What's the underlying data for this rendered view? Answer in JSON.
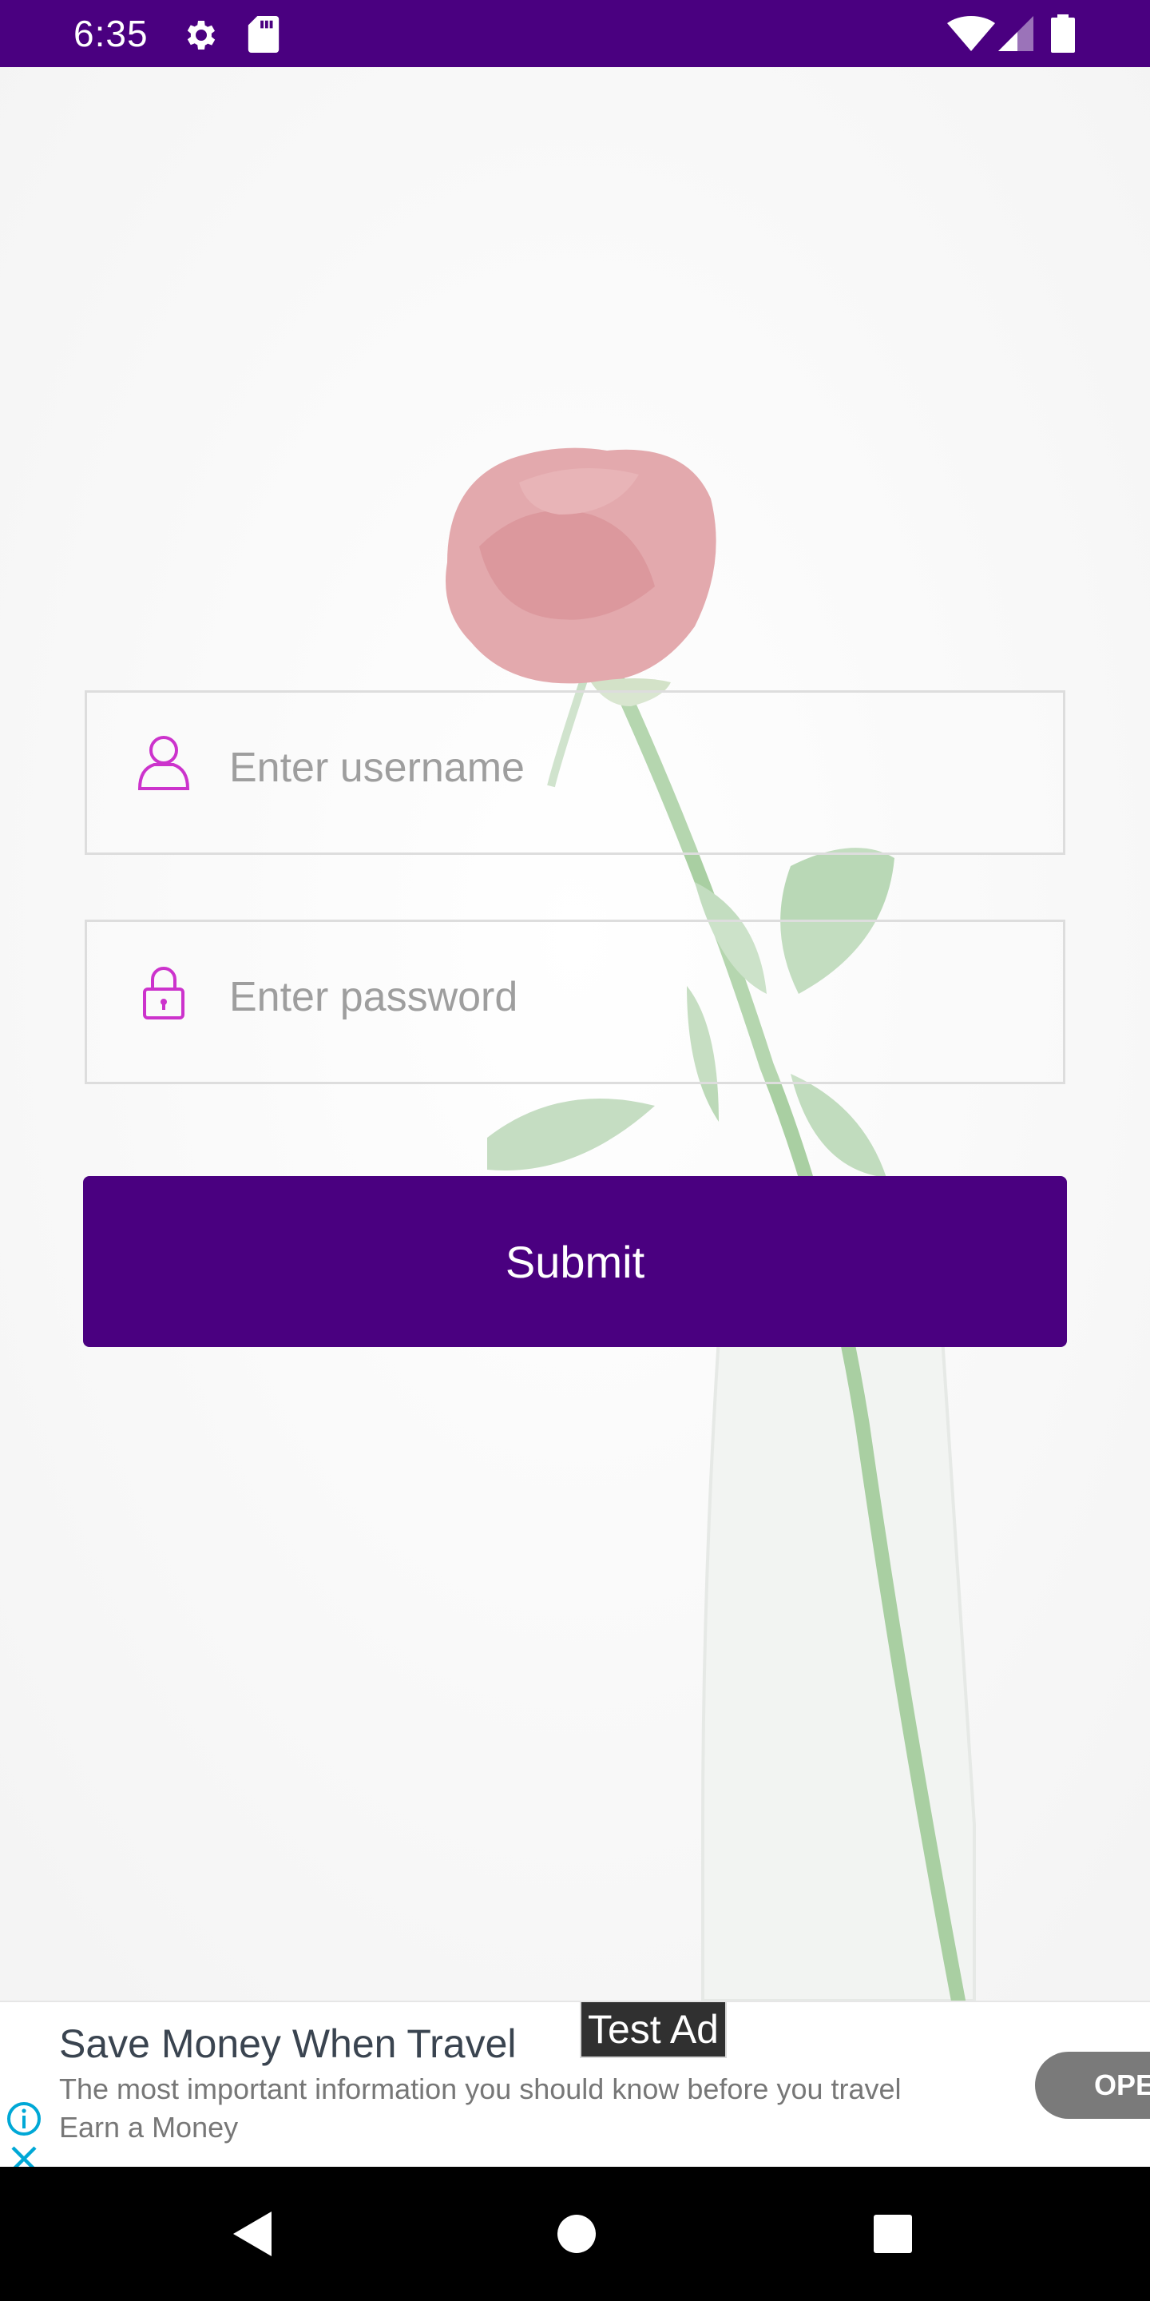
{
  "status_bar": {
    "time": "6:35",
    "icons": [
      "settings-gear-icon",
      "sd-card-icon",
      "wifi-icon",
      "cell-signal-icon",
      "battery-icon"
    ]
  },
  "login": {
    "username_placeholder": "Enter username",
    "password_placeholder": "Enter password",
    "submit_label": "Submit"
  },
  "ad": {
    "title": "Save Money When Travel",
    "badge": "Test Ad",
    "description": "The most important information you should know before you travel",
    "advertiser": "Earn a Money",
    "cta": "OPEN",
    "icons": [
      "info-icon",
      "close-icon"
    ]
  },
  "nav_bar": {
    "icons": [
      "back-icon",
      "home-icon",
      "recents-icon"
    ]
  },
  "colors": {
    "primary": "#4a0080",
    "field_icon": "#cc33cc",
    "placeholder": "#9e9e9e",
    "ad_accent": "#00a8d6"
  }
}
